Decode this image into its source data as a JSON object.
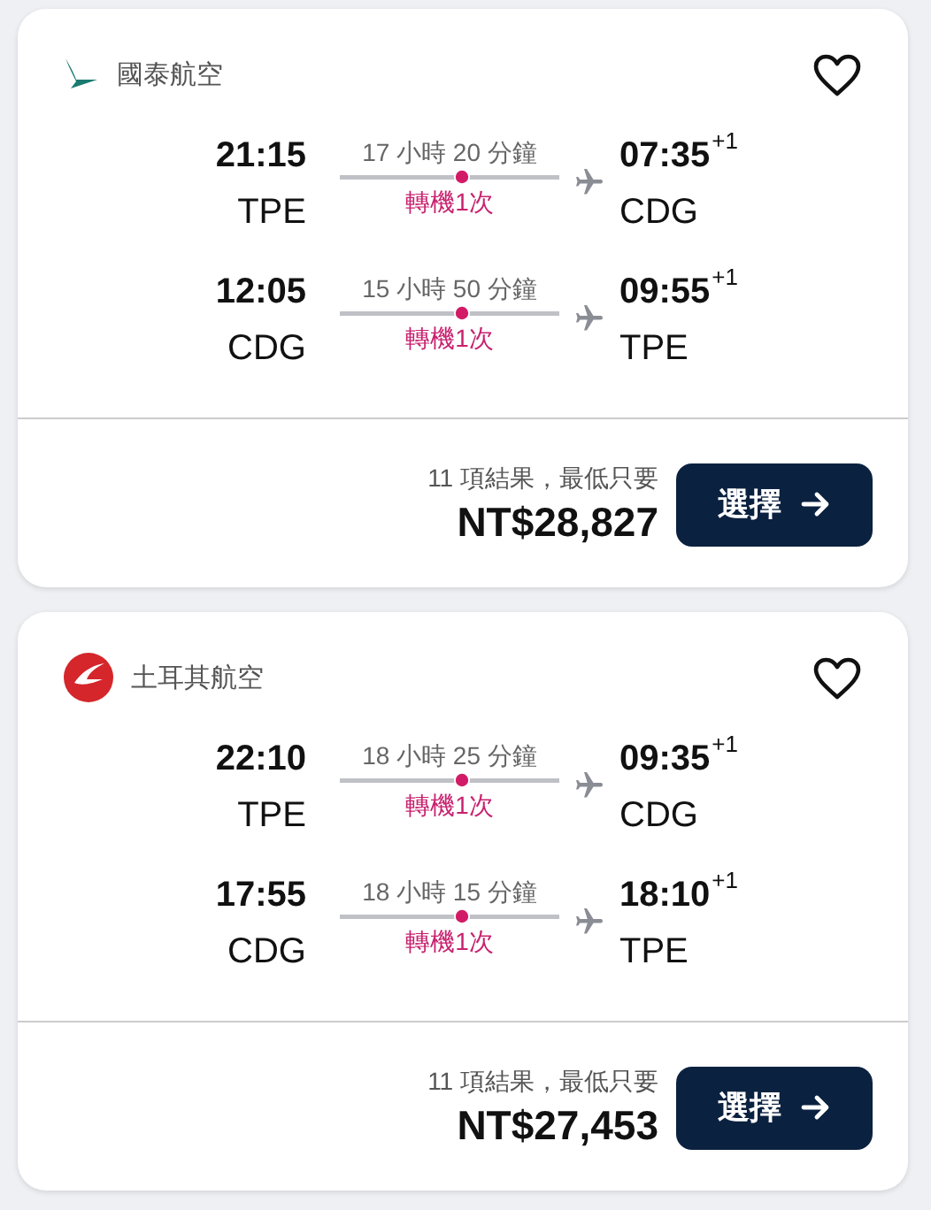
{
  "results": [
    {
      "airline": {
        "name": "國泰航空",
        "kind": "cathay"
      },
      "saved": false,
      "legs": [
        {
          "depart_time": "21:15",
          "depart_code": "TPE",
          "duration": "17 小時 20 分鐘",
          "stops": "轉機1次",
          "arrive_time": "07:35",
          "day_offset": "+1",
          "arrive_code": "CDG"
        },
        {
          "depart_time": "12:05",
          "depart_code": "CDG",
          "duration": "15 小時 50 分鐘",
          "stops": "轉機1次",
          "arrive_time": "09:55",
          "day_offset": "+1",
          "arrive_code": "TPE"
        }
      ],
      "summary": "11 項結果，最低只要",
      "price": "NT$28,827",
      "button": "選擇"
    },
    {
      "airline": {
        "name": "土耳其航空",
        "kind": "turkish"
      },
      "saved": false,
      "legs": [
        {
          "depart_time": "22:10",
          "depart_code": "TPE",
          "duration": "18 小時 25 分鐘",
          "stops": "轉機1次",
          "arrive_time": "09:35",
          "day_offset": "+1",
          "arrive_code": "CDG"
        },
        {
          "depart_time": "17:55",
          "depart_code": "CDG",
          "duration": "18 小時 15 分鐘",
          "stops": "轉機1次",
          "arrive_time": "18:10",
          "day_offset": "+1",
          "arrive_code": "TPE"
        }
      ],
      "summary": "11 項結果，最低只要",
      "price": "NT$27,453",
      "button": "選擇"
    }
  ]
}
